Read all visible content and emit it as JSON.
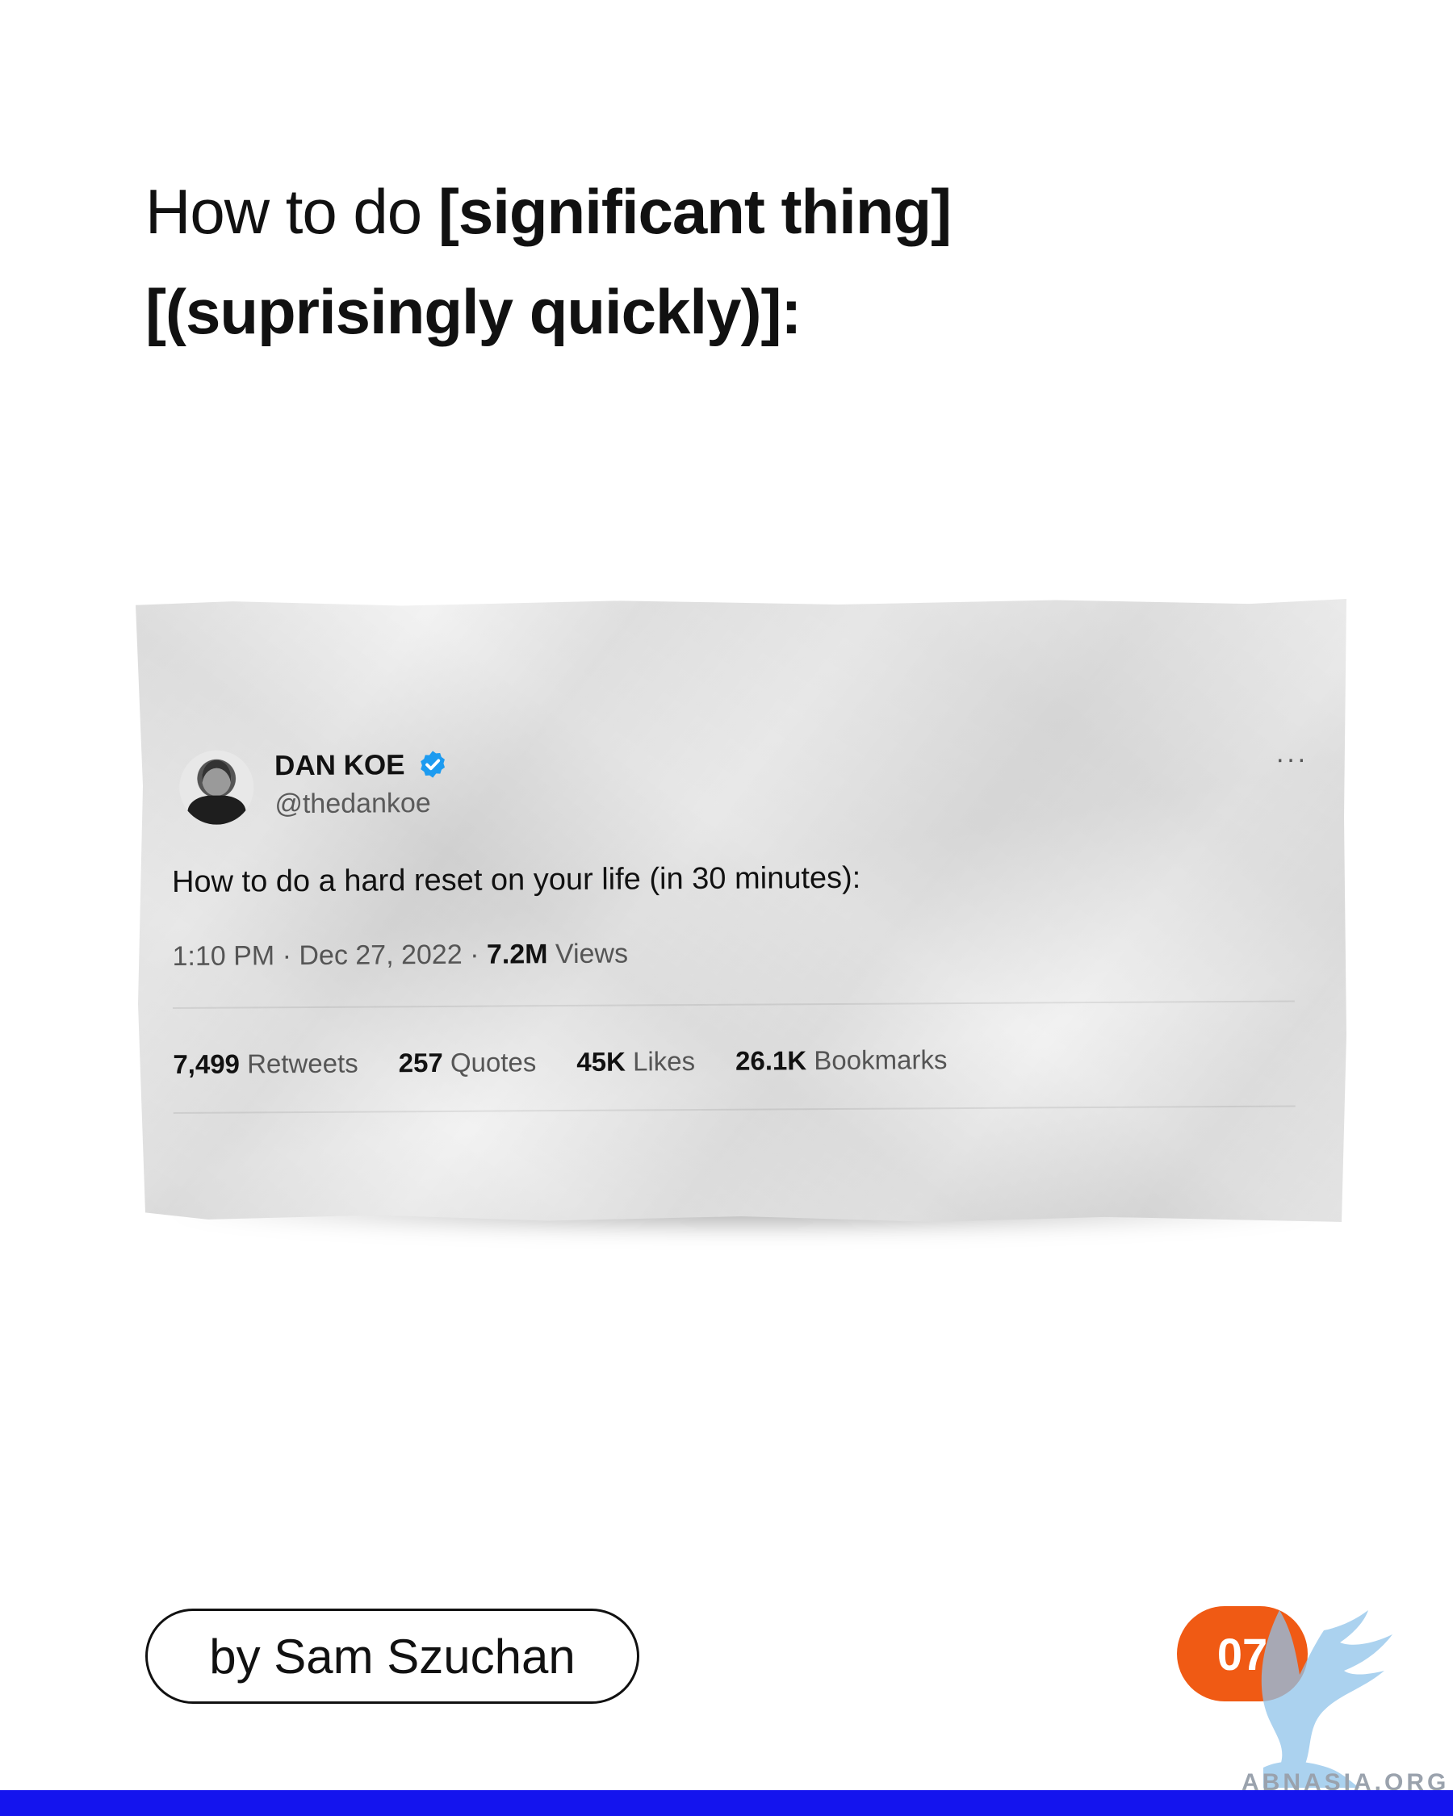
{
  "headline": {
    "prefix": "How to do ",
    "bold_part1": "[significant thing]",
    "bold_part2": "[(suprisingly quickly)]:"
  },
  "tweet": {
    "author_name": "DAN KOE",
    "handle": "@thedankoe",
    "verified_icon": "verified-badge-icon",
    "text": "How to do a hard reset on your life (in 30 minutes):",
    "time": "1:10 PM",
    "date": "Dec 27, 2022",
    "views_count": "7.2M",
    "views_label": "Views",
    "stats": {
      "retweets_count": "7,499",
      "retweets_label": "Retweets",
      "quotes_count": "257",
      "quotes_label": "Quotes",
      "likes_count": "45K",
      "likes_label": "Likes",
      "bookmarks_count": "26.1K",
      "bookmarks_label": "Bookmarks"
    },
    "more_icon": "more-options-icon",
    "verified_color": "#1d9bf0"
  },
  "byline": "by Sam Szuchan",
  "page_number": "07",
  "watermark": "ABNASIA.ORG",
  "colors": {
    "badge": "#f05a14",
    "bottom_bar": "#1414ee"
  }
}
